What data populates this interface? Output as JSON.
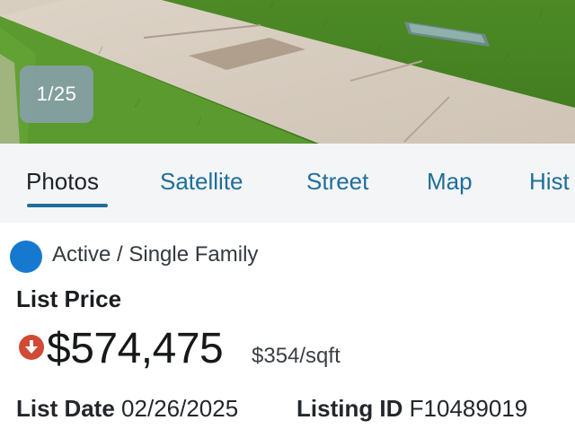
{
  "photo": {
    "counter": "1/25"
  },
  "tabs": [
    {
      "label": "Photos",
      "active": true
    },
    {
      "label": "Satellite",
      "active": false
    },
    {
      "label": "Street",
      "active": false
    },
    {
      "label": "Map",
      "active": false
    },
    {
      "label": "Hist",
      "active": false
    }
  ],
  "listing": {
    "status": "Active / Single Family",
    "status_color": "#1679cf",
    "price_label": "List Price",
    "price_trend_icon": "price-down-arrow-icon",
    "price_trend_color": "#d14a35",
    "price": "$574,475",
    "price_per_sqft": "$354/sqft",
    "list_date_label": "List Date",
    "list_date": "02/26/2025",
    "listing_id_label": "Listing ID",
    "listing_id": "F10489019"
  },
  "colors": {
    "tab_accent": "#1f6e9a",
    "tab_bar_bg": "#f4f5f7"
  }
}
